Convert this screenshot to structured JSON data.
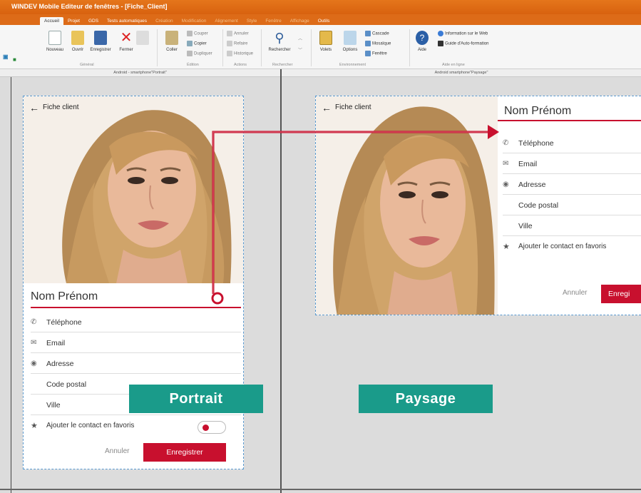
{
  "window": {
    "title": "WINDEV Mobile Editeur de fenêtres - [Fiche_Client]"
  },
  "ribbon_tabs": [
    "Accueil",
    "Projet",
    "GDS",
    "Tests automatiques",
    "Création",
    "Modification",
    "Alignement",
    "Style",
    "Fenêtre",
    "Affichage",
    "Outils"
  ],
  "ribbon": {
    "nouveau": "Nouveau",
    "ouvrir": "Ouvrir",
    "enregistrer": "Enregistrer",
    "fermer": "Fermer",
    "coller": "Coller",
    "couper": "Couper",
    "copier": "Copier",
    "dupliquer": "Dupliquer",
    "annuler": "Annuler",
    "refaire": "Refaire",
    "historique": "Historique",
    "rechercher": "Rechercher",
    "volets": "Volets",
    "options": "Options",
    "cascade": "Cascade",
    "mosaique": "Mosaïque",
    "fenetre": "Fenêtre",
    "aide": "Aide",
    "info_web": "Information sur le Web",
    "guide": "Guide d'Auto-formation",
    "groups": {
      "general": "Général",
      "edition": "Édition",
      "actions": "Actions",
      "recherche": "Rechercher",
      "environnement": "Environnement",
      "aide": "Aide en ligne"
    }
  },
  "panes": {
    "portrait_header": "Android - smartphone\"Portrait\"",
    "paysage_header": "Android smartphone\"Paysage\""
  },
  "form": {
    "back_label": "Fiche client",
    "name": "Nom Prénom",
    "phone": "Téléphone",
    "email": "Email",
    "address": "Adresse",
    "postal": "Code postal",
    "city": "Ville",
    "favorite": "Ajouter le contact en favoris",
    "cancel": "Annuler",
    "save": "Enregistrer",
    "save_cropped": "Enregi"
  },
  "labels": {
    "portrait": "Portrait",
    "paysage": "Paysage"
  },
  "colors": {
    "accent": "#c8102e",
    "label_bg": "#1a9b8a",
    "ribbon_orange": "#dd6b18"
  },
  "icons": [
    "back-arrow-icon",
    "phone-icon",
    "email-icon",
    "location-icon",
    "star-icon",
    "toggle-switch"
  ]
}
